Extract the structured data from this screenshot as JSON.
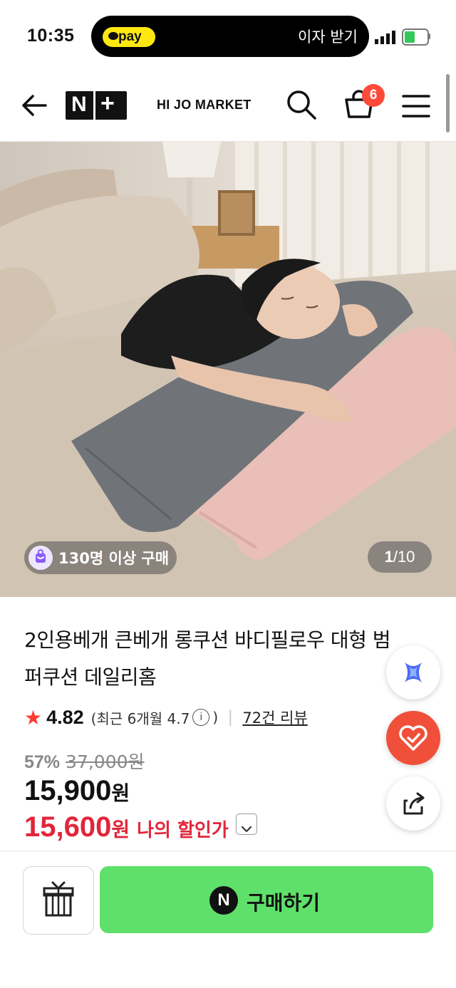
{
  "status_bar": {
    "time": "10:35",
    "pay_label": "pay",
    "island_text": "이자 받기"
  },
  "header": {
    "brand_logo_text": "N+",
    "brand_name": "HI JO MARKET",
    "cart_count": "6"
  },
  "hero": {
    "buyers_text": "130명 이상 구매",
    "page_current": "1",
    "page_total": "/10"
  },
  "product": {
    "title": "2인용베개 큰베개 롱쿠션 바디필로우 대형 범퍼쿠션 데일리홈",
    "rating": "4.82",
    "recent_rating_prefix": "(최근 6개월 4.7",
    "recent_rating_suffix": ")",
    "review_count": "72건 리뷰",
    "discount_percent": "57%",
    "original_price": "37,000원",
    "price_number": "15,900",
    "price_unit": "원",
    "my_price_number": "15,600",
    "my_price_unit": "원",
    "my_price_label": "나의 할인가"
  },
  "bottom_bar": {
    "buy_logo": "N",
    "buy_label": "구매하기"
  },
  "colors": {
    "accent_green": "#5ee06a",
    "price_red": "#e1263a",
    "badge_red": "#ff4a3a",
    "pay_yellow": "#ffe812"
  }
}
